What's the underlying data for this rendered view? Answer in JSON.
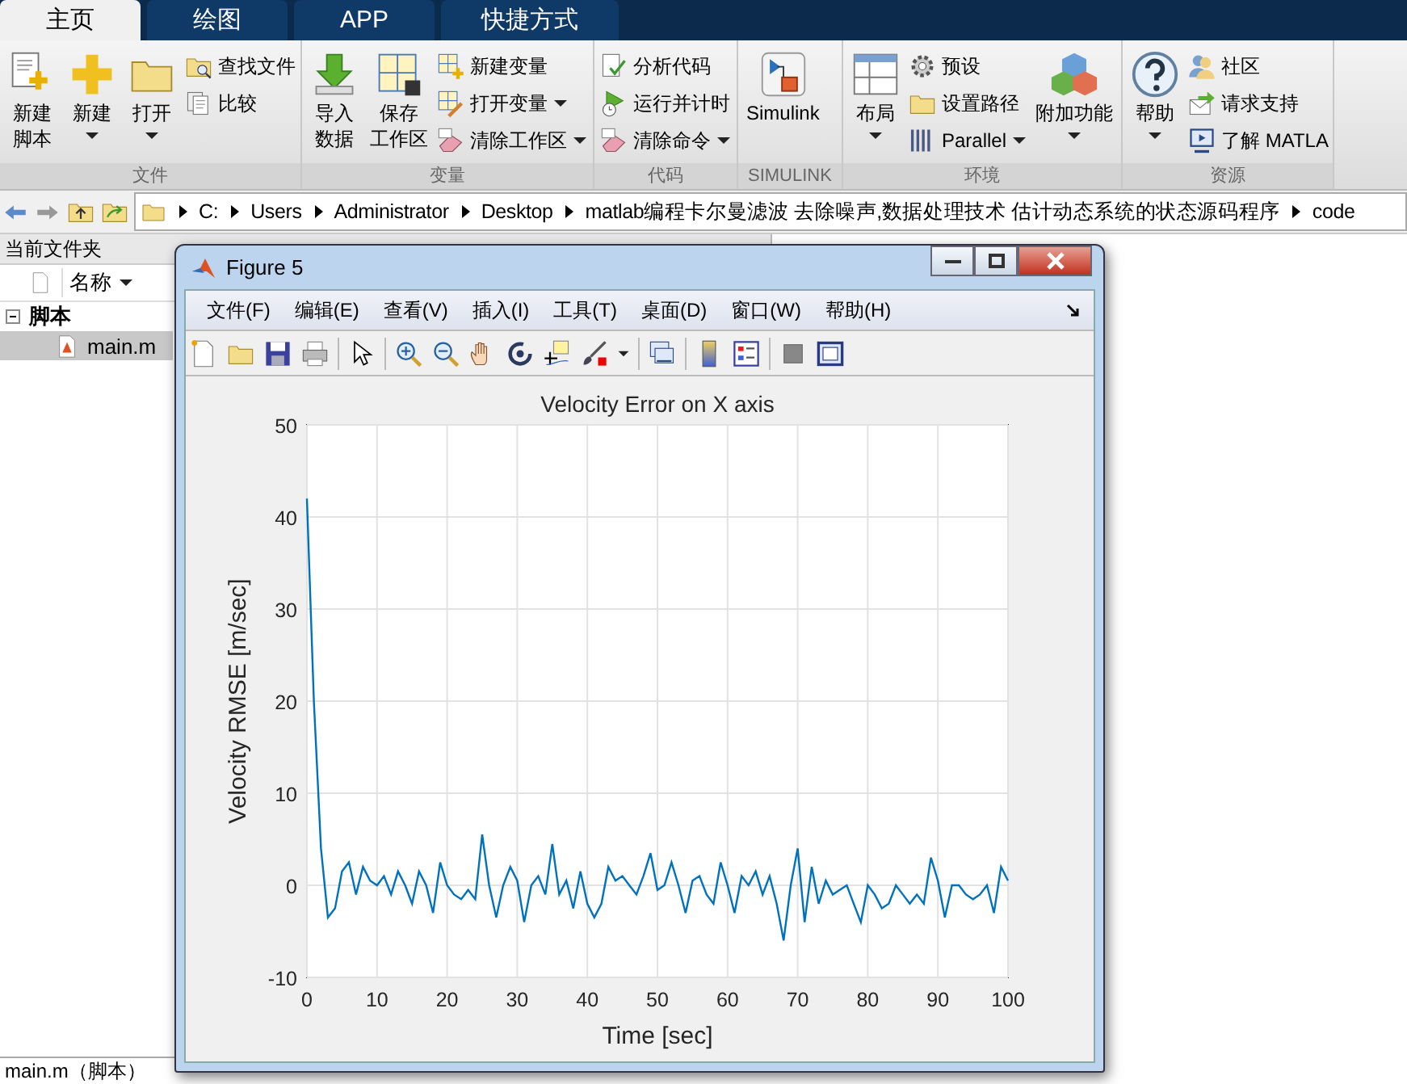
{
  "ribbon_tabs": [
    {
      "label": "主页",
      "selected": true
    },
    {
      "label": "绘图",
      "selected": false
    },
    {
      "label": "APP",
      "selected": false
    },
    {
      "label": "快捷方式",
      "selected": false
    }
  ],
  "ribbon_groups": [
    {
      "label": "文件",
      "items": [
        {
          "kind": "large",
          "lines": [
            "新建",
            "脚本"
          ],
          "dropdown": false
        },
        {
          "kind": "large",
          "label": "新建",
          "dropdown": true
        },
        {
          "kind": "large",
          "label": "打开",
          "dropdown": true
        },
        {
          "kind": "stack",
          "items": [
            {
              "label": "查找文件",
              "dropdown": false
            },
            {
              "label": "比较",
              "dropdown": false
            }
          ]
        }
      ]
    },
    {
      "label": "变量",
      "items": [
        {
          "kind": "large",
          "lines": [
            "导入",
            "数据"
          ],
          "dropdown": false
        },
        {
          "kind": "large",
          "lines": [
            "保存",
            "工作区"
          ],
          "dropdown": false
        },
        {
          "kind": "stack",
          "items": [
            {
              "label": "新建变量",
              "dropdown": false
            },
            {
              "label": "打开变量",
              "dropdown": true
            },
            {
              "label": "清除工作区",
              "dropdown": true
            }
          ]
        }
      ]
    },
    {
      "label": "代码",
      "items": [
        {
          "kind": "stack",
          "items": [
            {
              "label": "分析代码",
              "dropdown": false
            },
            {
              "label": "运行并计时",
              "dropdown": false
            },
            {
              "label": "清除命令",
              "dropdown": true
            }
          ]
        }
      ]
    },
    {
      "label": "SIMULINK",
      "items": [
        {
          "kind": "large",
          "label": "Simulink",
          "dropdown": false
        }
      ]
    },
    {
      "label": "环境",
      "items": [
        {
          "kind": "large",
          "label": "布局",
          "dropdown": true
        },
        {
          "kind": "stack",
          "items": [
            {
              "label": "预设",
              "dropdown": false
            },
            {
              "label": "设置路径",
              "dropdown": false
            },
            {
              "label": "Parallel",
              "dropdown": true
            }
          ]
        },
        {
          "kind": "large",
          "label": "附加功能",
          "dropdown": true
        }
      ]
    },
    {
      "label": "资源",
      "items": [
        {
          "kind": "large",
          "label": "帮助",
          "dropdown": true
        },
        {
          "kind": "stack",
          "items": [
            {
              "label": "社区",
              "dropdown": false
            },
            {
              "label": "请求支持",
              "dropdown": false
            },
            {
              "label": "了解 MATLA",
              "dropdown": false
            }
          ]
        }
      ]
    }
  ],
  "address_bar": {
    "segments": [
      "C:",
      "Users",
      "Administrator",
      "Desktop",
      "matlab编程卡尔曼滤波 去除噪声,数据处理技术 估计动态系统的状态源码程序",
      "code"
    ]
  },
  "current_folder": {
    "title": "当前文件夹",
    "column": "名称",
    "groups": [
      {
        "label": "脚本",
        "expanded": true,
        "children": [
          {
            "label": "main.m",
            "selected": true
          }
        ]
      }
    ]
  },
  "status_bar": {
    "text": "main.m（脚本）"
  },
  "figure": {
    "title": "Figure 5",
    "menu": [
      "文件(F)",
      "编辑(E)",
      "查看(V)",
      "插入(I)",
      "工具(T)",
      "桌面(D)",
      "窗口(W)",
      "帮助(H)"
    ],
    "chart_data": {
      "type": "line",
      "grid": true,
      "title": "Velocity Error on X axis",
      "xlabel": "Time [sec]",
      "ylabel": "Velocity RMSE [m/sec]",
      "xlim": [
        0,
        100
      ],
      "ylim": [
        -10,
        50
      ],
      "xticks": [
        0,
        10,
        20,
        30,
        40,
        50,
        60,
        70,
        80,
        90,
        100
      ],
      "yticks": [
        -10,
        0,
        10,
        20,
        30,
        40,
        50
      ],
      "x": [
        0,
        1,
        2,
        3,
        4,
        5,
        6,
        7,
        8,
        9,
        10,
        11,
        12,
        13,
        14,
        15,
        16,
        17,
        18,
        19,
        20,
        21,
        22,
        23,
        24,
        25,
        26,
        27,
        28,
        29,
        30,
        31,
        32,
        33,
        34,
        35,
        36,
        37,
        38,
        39,
        40,
        41,
        42,
        43,
        44,
        45,
        46,
        47,
        48,
        49,
        50,
        51,
        52,
        53,
        54,
        55,
        56,
        57,
        58,
        59,
        60,
        61,
        62,
        63,
        64,
        65,
        66,
        67,
        68,
        69,
        70,
        71,
        72,
        73,
        74,
        75,
        76,
        77,
        78,
        79,
        80,
        81,
        82,
        83,
        84,
        85,
        86,
        87,
        88,
        89,
        90,
        91,
        92,
        93,
        94,
        95,
        96,
        97,
        98,
        99,
        100
      ],
      "series": [
        {
          "color": "#0072bd",
          "values": [
            42,
            20,
            4,
            -3.5,
            -2.5,
            1.5,
            2.5,
            -1,
            2,
            0.5,
            0,
            1,
            -1,
            1.5,
            0,
            -2,
            1.5,
            0,
            -3,
            2.5,
            0,
            -1,
            -1.5,
            -0.5,
            -1.5,
            5.5,
            0,
            -3.5,
            0,
            2,
            0.5,
            -4,
            0,
            1,
            -1,
            4.5,
            -1,
            0.5,
            -2.5,
            1.5,
            -2,
            -3.5,
            -2,
            2,
            0.5,
            1,
            0,
            -1,
            1,
            3.5,
            -0.5,
            0,
            2.5,
            0,
            -3,
            0.5,
            1,
            -1,
            -2,
            2.5,
            0,
            -3,
            1,
            0,
            1.5,
            -1,
            1,
            -2,
            -6,
            0,
            4,
            -4,
            2,
            -2,
            0.5,
            -1,
            -0.5,
            0,
            -2,
            -4,
            0,
            -1,
            -2.5,
            -2,
            0,
            -1,
            -2,
            -1,
            -2,
            3,
            0.5,
            -3.5,
            0,
            0,
            -1,
            -1.5,
            -1,
            0,
            -3,
            2,
            0.5
          ]
        }
      ]
    }
  }
}
